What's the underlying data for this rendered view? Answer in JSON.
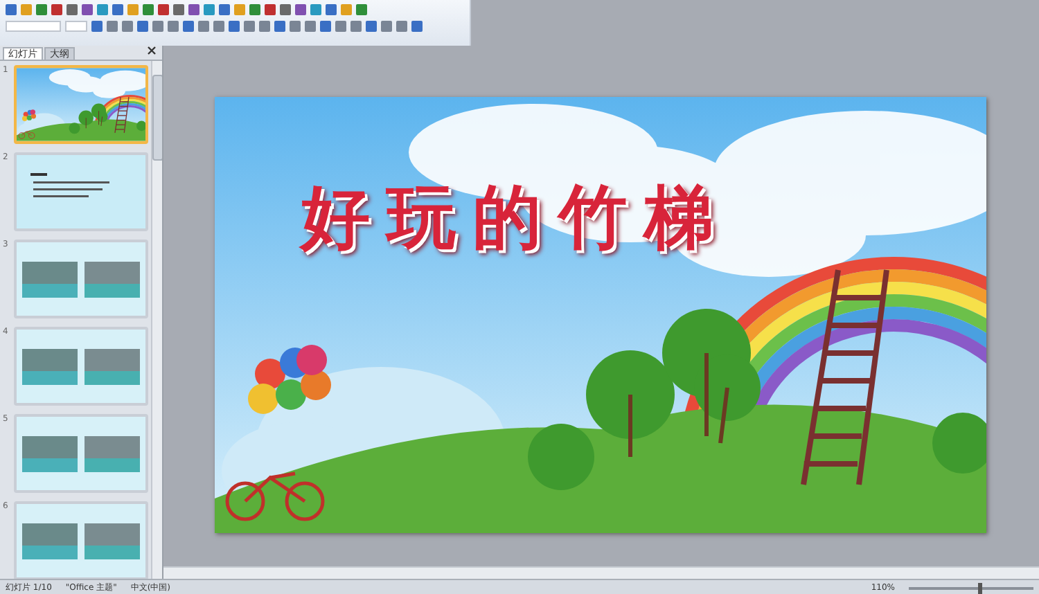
{
  "panel_tabs": [
    {
      "label": "幻灯片",
      "selected": true
    },
    {
      "label": "大纲",
      "selected": false
    }
  ],
  "thumbnails": [
    {
      "number": "1",
      "kind": "title",
      "selected": true
    },
    {
      "number": "2",
      "kind": "text",
      "selected": false
    },
    {
      "number": "3",
      "kind": "photos",
      "selected": false
    },
    {
      "number": "4",
      "kind": "photos",
      "selected": false
    },
    {
      "number": "5",
      "kind": "photos",
      "selected": false
    },
    {
      "number": "6",
      "kind": "photos",
      "selected": false
    }
  ],
  "slide": {
    "title": "好玩的竹梯"
  },
  "status_bar": {
    "slide_info": "幻灯片 1/10",
    "theme": "\"Office 主题\"",
    "language": "中文(中国)",
    "zoom": "110%",
    "level": 0.55
  }
}
